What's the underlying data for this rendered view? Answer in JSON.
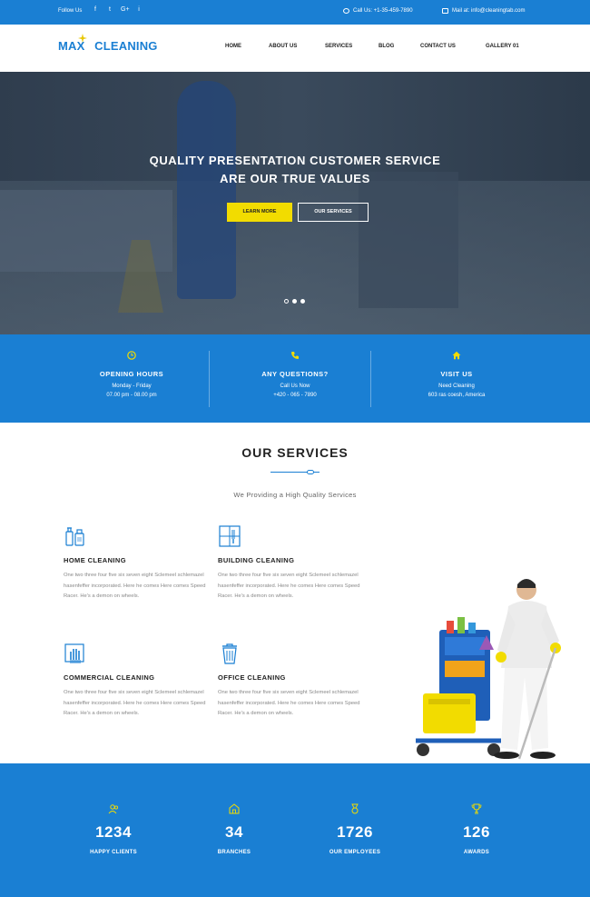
{
  "topbar": {
    "follow_label": "Follow Us",
    "social_icons": [
      "facebook-icon",
      "twitter-icon",
      "google-plus-icon",
      "instagram-icon"
    ],
    "social_glyphs": [
      "f",
      "t",
      "G+",
      "i"
    ],
    "call": "Call Us: +1-35-459-7890",
    "mail": "Mail at: info@cleaningtab.com"
  },
  "header": {
    "logo_max": "MAX",
    "logo_cleaning": "CLEANING",
    "nav": [
      "HOME",
      "ABOUT US",
      "SERVICES",
      "BLOG",
      "CONTACT US",
      "GALLERY 01"
    ]
  },
  "hero": {
    "title_line1": "QUALITY PRESENTATION CUSTOMER SERVICE",
    "title_line2": "ARE OUR TRUE VALUES",
    "learn_more": "LEARN MORE",
    "our_services": "OUR SERVICES",
    "slides": 3,
    "active_slide": 1
  },
  "info": [
    {
      "icon": "clock-icon",
      "title": "OPENING HOURS",
      "line1": "Monday - Friday",
      "line2": "07.00 pm - 08.00 pm"
    },
    {
      "icon": "phone-icon",
      "title": "ANY QUESTIONS?",
      "line1": "Call Us Now",
      "line2": "+420 - 065 - 7890"
    },
    {
      "icon": "home-icon",
      "title": "VISIT US",
      "line1": "Need Cleaning",
      "line2": "603 ras coesh, America"
    }
  ],
  "services": {
    "heading": "OUR SERVICES",
    "subheading": "We Providing a High Quality Services",
    "items": [
      {
        "icon": "spray-bottles-icon",
        "title": "HOME CLEANING",
        "desc": "One two three four five six seven eight Sclemeel schlemazel hasenfeffer incorporated. Here he comes Here comes Speed Racer. He's a demon on wheels."
      },
      {
        "icon": "window-cleaning-icon",
        "title": "BUILDING CLEANING",
        "desc": "One two three four five six seven eight Sclemeel schlemazel hasenfeffer incorporated. Here he comes Here comes Speed Racer. He's a demon on wheels."
      },
      {
        "icon": "glove-icon",
        "title": "COMMERCIAL CLEANING",
        "desc": "One two three four five six seven eight Sclemeel schlemazel hasenfeffer incorporated. Here he comes Here comes Speed Racer. He's a demon on wheels."
      },
      {
        "icon": "trash-bin-icon",
        "title": "OFFICE CLEANING",
        "desc": "One two three four five six seven eight Sclemeel schlemazel hasenfeffer incorporated. Here he comes Here comes Speed Racer. He's a demon on wheels."
      }
    ]
  },
  "stats": [
    {
      "icon": "users-icon",
      "number": "1234",
      "label": "HAPPY CLIENTS"
    },
    {
      "icon": "building-icon",
      "number": "34",
      "label": "BRANCHES"
    },
    {
      "icon": "employee-badge-icon",
      "number": "1726",
      "label": "OUR EMPLOYEES"
    },
    {
      "icon": "trophy-icon",
      "number": "126",
      "label": "AWARDS"
    }
  ],
  "colors": {
    "brand_blue": "#1a7fd3",
    "accent_yellow": "#f2dc00",
    "text_dark": "#222222"
  }
}
